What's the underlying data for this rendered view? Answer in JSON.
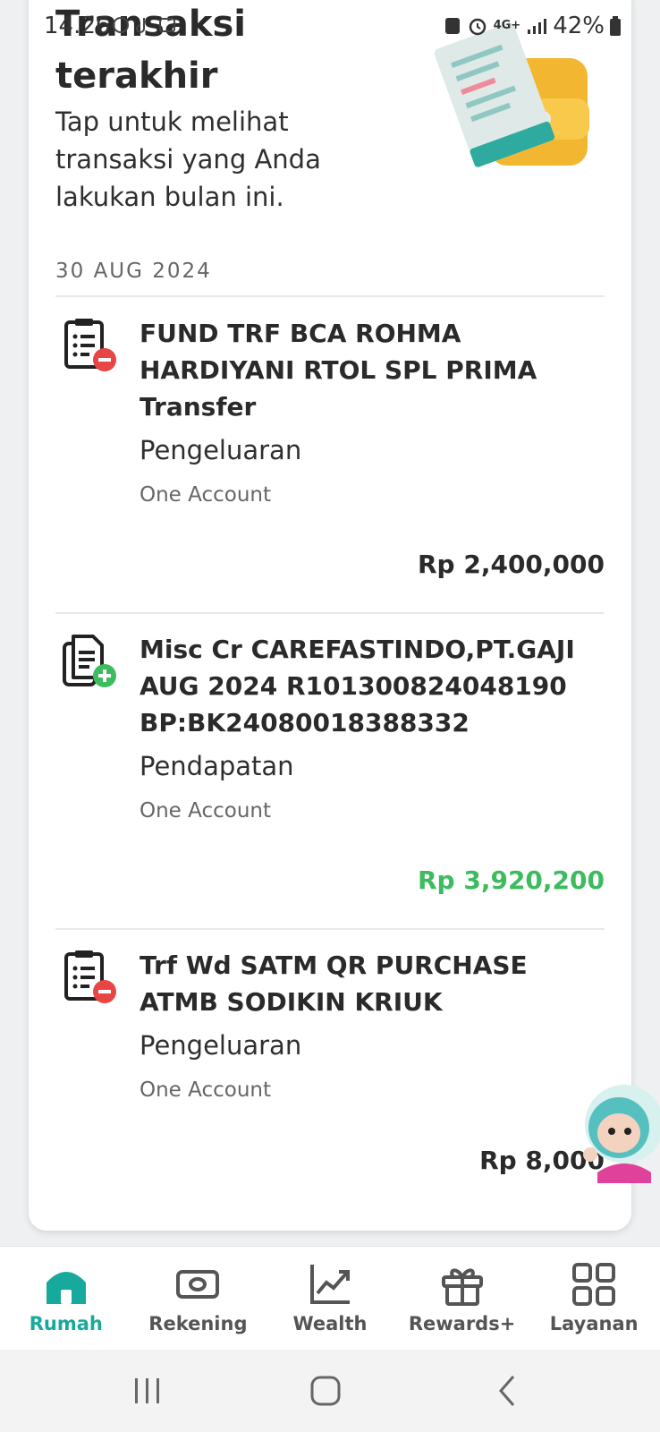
{
  "status_bar": {
    "time": "14.26",
    "network": "4G+",
    "battery": "42%"
  },
  "header": {
    "title": "Transaksi terakhir",
    "subtitle": "Tap untuk melihat transaksi yang Anda lakukan bulan ini."
  },
  "date_group": "30 AUG 2024",
  "transactions": [
    {
      "title": "FUND TRF BCA ROHMA HARDIYANI RTOL SPL PRIMA Transfer",
      "type": "Pengeluaran",
      "account": "One Account",
      "amount": "Rp 2,400,000",
      "icon": "expense-receipt-icon"
    },
    {
      "title": "Misc Cr CAREFASTINDO,PT.GAJI AUG 2024 R101300824048190 BP:BK24080018388332",
      "type": "Pendapatan",
      "account": "One Account",
      "amount": "Rp 3,920,200",
      "icon": "income-receipt-icon"
    },
    {
      "title": "Trf Wd SATM QR PURCHASE ATMB SODIKIN KRIUK",
      "type": "Pengeluaran",
      "account": "One Account",
      "amount": "Rp 8,000",
      "icon": "expense-receipt-icon"
    }
  ],
  "nav": [
    {
      "label": "Rumah",
      "icon": "home-icon",
      "active": true
    },
    {
      "label": "Rekening",
      "icon": "cash-icon",
      "active": false
    },
    {
      "label": "Wealth",
      "icon": "chart-icon",
      "active": false
    },
    {
      "label": "Rewards+",
      "icon": "gift-icon",
      "active": false
    },
    {
      "label": "Layanan",
      "icon": "grid-icon",
      "active": false
    }
  ],
  "colors": {
    "accent": "#18a99d",
    "income": "#3dbb5e",
    "expense_badge": "#e84545",
    "income_badge": "#3dbb5e"
  }
}
